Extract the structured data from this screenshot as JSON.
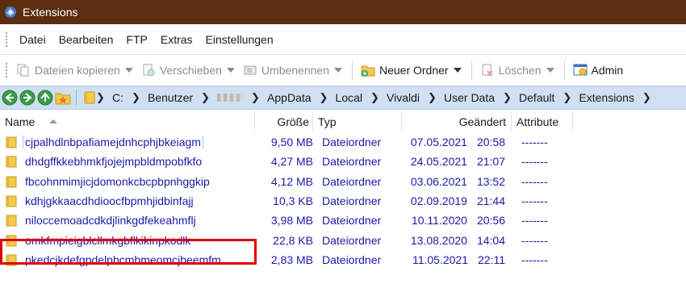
{
  "window": {
    "title": "Extensions"
  },
  "menu": [
    "Datei",
    "Bearbeiten",
    "FTP",
    "Extras",
    "Einstellungen"
  ],
  "toolbar": {
    "copy": "Dateien kopieren",
    "move": "Verschieben",
    "rename": "Umbenennen",
    "new_folder": "Neuer Ordner",
    "delete": "Löschen",
    "admin": "Admin"
  },
  "path": {
    "items": [
      "C:",
      "Benutzer",
      "AppData",
      "Local",
      "Vivaldi",
      "User Data",
      "Default",
      "Extensions"
    ]
  },
  "columns": {
    "name": "Name",
    "size": "Größe",
    "type": "Typ",
    "modified": "Geändert",
    "attributes": "Attribute"
  },
  "files": [
    {
      "name": "cjpalhdlnbpafiamejdnhcphjbkeiagm",
      "size": "9,50 MB",
      "type": "Dateiordner",
      "date": "07.05.2021",
      "time": "20:58",
      "attr": "-------"
    },
    {
      "name": "dhdgffkkebhmkfjojejmpbldmpobfkfo",
      "size": "4,27 MB",
      "type": "Dateiordner",
      "date": "24.05.2021",
      "time": "21:07",
      "attr": "-------"
    },
    {
      "name": "fbcohnmimjicjdomonkcbcpbpnhggkip",
      "size": "4,12 MB",
      "type": "Dateiordner",
      "date": "03.06.2021",
      "time": "13:52",
      "attr": "-------"
    },
    {
      "name": "kdhjgkkaacdhdioocfbpmhjidbinfajj",
      "size": "10,3 KB",
      "type": "Dateiordner",
      "date": "02.09.2019",
      "time": "21:44",
      "attr": "-------"
    },
    {
      "name": "niloccemoadcdkdjlinkgdfekeahmflj",
      "size": "3,98 MB",
      "type": "Dateiordner",
      "date": "10.11.2020",
      "time": "20:56",
      "attr": "-------"
    },
    {
      "name": "omkfmpieigblcllmkgbflkikinpkodlk",
      "size": "22,8 KB",
      "type": "Dateiordner",
      "date": "13.08.2020",
      "time": "14:04",
      "attr": "-------"
    },
    {
      "name": "pkedcjkdefgpdelpbcmbmeomcjbeemfm",
      "size": "2,83 MB",
      "type": "Dateiordner",
      "date": "11.05.2021",
      "time": "22:11",
      "attr": "-------"
    }
  ],
  "colors": {
    "titlebar": "#5c2d0e",
    "addressbar": "#cfe0f2",
    "file_text": "#1a1aa8",
    "highlight": "#e00000"
  }
}
